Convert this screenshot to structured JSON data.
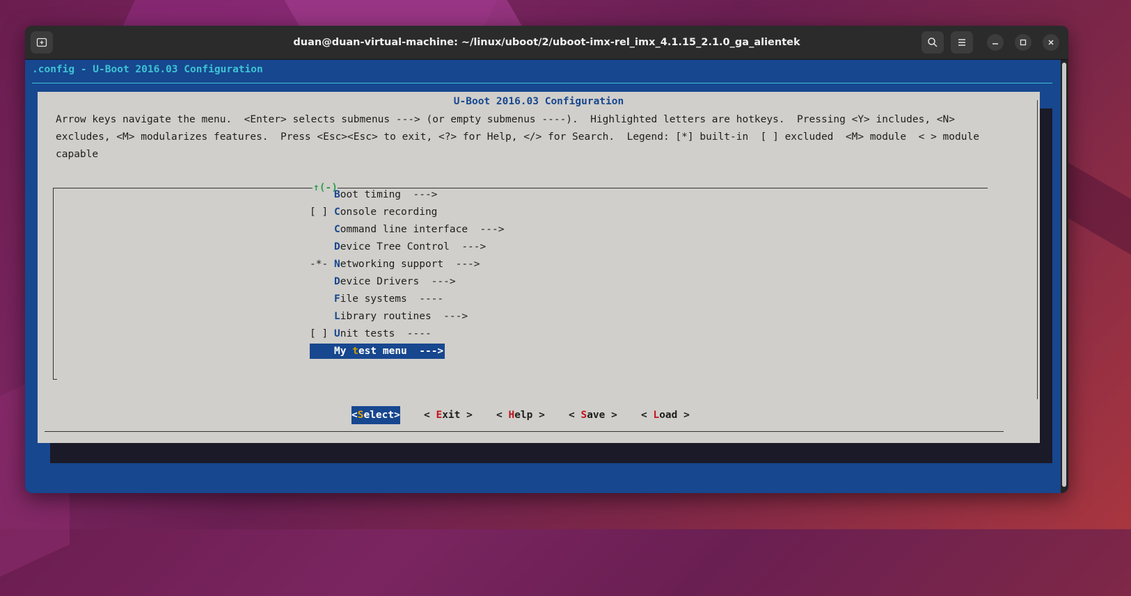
{
  "window": {
    "title": "duan@duan-virtual-machine: ~/linux/uboot/2/uboot-imx-rel_imx_4.1.15_2.1.0_ga_alientek",
    "icons": [
      "new-tab-icon",
      "search-icon",
      "hamburger-menu-icon",
      "minimize-icon",
      "maximize-icon",
      "close-icon"
    ]
  },
  "terminal": {
    "header": ".config - U-Boot 2016.03 Configuration",
    "dialog_title": "U-Boot 2016.03 Configuration",
    "help_text": "Arrow keys navigate the menu.  <Enter> selects submenus ---> (or empty submenus ----).  Highlighted letters are hotkeys.  Pressing <Y> includes, <N>\nexcludes, <M> modularizes features.  Press <Esc><Esc> to exit, <?> for Help, </> for Search.  Legend: [*] built-in  [ ] excluded  <M> module  < > module\ncapable",
    "scroll_indicator": "↑(-)",
    "menu_items": [
      {
        "prefix": "",
        "hot": "B",
        "rest": "oot timing  --->",
        "selected": false
      },
      {
        "prefix": "[ ]",
        "hot": "C",
        "rest": "onsole recording",
        "selected": false
      },
      {
        "prefix": "",
        "hot": "C",
        "rest": "ommand line interface  --->",
        "selected": false
      },
      {
        "prefix": "",
        "hot": "D",
        "rest": "evice Tree Control  --->",
        "selected": false
      },
      {
        "prefix": "-*-",
        "hot": "N",
        "rest": "etworking support  --->",
        "selected": false
      },
      {
        "prefix": "",
        "hot": "D",
        "rest": "evice Drivers  --->",
        "selected": false
      },
      {
        "prefix": "",
        "hot": "F",
        "rest": "ile systems  ----",
        "selected": false
      },
      {
        "prefix": "",
        "hot": "L",
        "rest": "ibrary routines  --->",
        "selected": false
      },
      {
        "prefix": "[ ]",
        "hot": "U",
        "rest": "nit tests  ----",
        "selected": false
      },
      {
        "prefix": "",
        "pre": "My ",
        "hot": "t",
        "rest": "est menu  --->",
        "selected": true
      }
    ],
    "buttons": [
      {
        "open": "<",
        "hot": "S",
        "rest": "elect",
        "close": ">",
        "active": true
      },
      {
        "open": "< ",
        "hot": "E",
        "rest": "xit",
        "close": " >",
        "active": false
      },
      {
        "open": "< ",
        "hot": "H",
        "rest": "elp",
        "close": " >",
        "active": false
      },
      {
        "open": "< ",
        "hot": "S",
        "rest": "ave",
        "close": " >",
        "active": false
      },
      {
        "open": "< ",
        "hot": "L",
        "rest": "oad",
        "close": " >",
        "active": false
      }
    ]
  },
  "colors": {
    "terminal_bg": "#17478f",
    "dialog_bg": "#d0cfcb",
    "accent_cyan": "#3ec3d3",
    "hotkey_red": "#c0141c",
    "hotkey_selected": "#e0a400"
  }
}
